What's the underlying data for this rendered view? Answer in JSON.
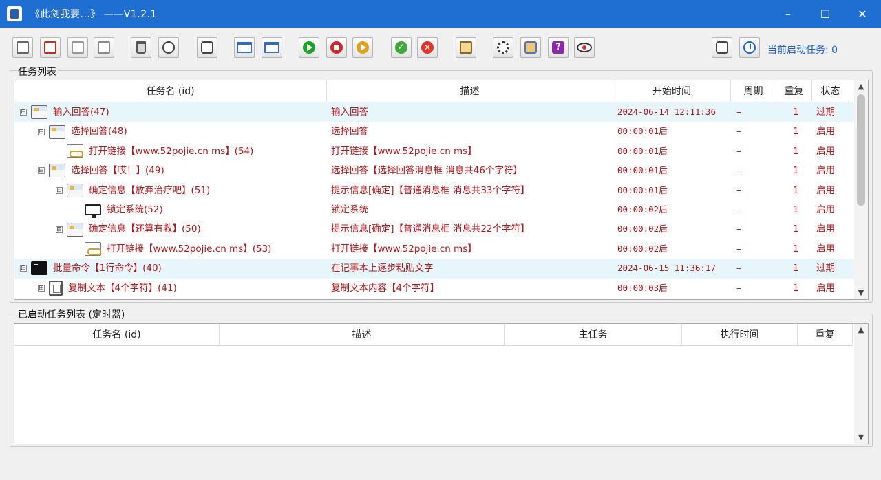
{
  "window": {
    "title": "《此剑我要...》    ——V1.2.1",
    "minimize": "–",
    "maximize": "☐",
    "close": "✕"
  },
  "toolbar": {
    "active_task_label": "当前启动任务: 0",
    "buttons": [
      {
        "name": "new-task",
        "icon": "new-task-icon"
      },
      {
        "name": "add-subtask",
        "icon": "add-subtask-icon"
      },
      {
        "name": "copy-task",
        "icon": "copy-task-icon"
      },
      {
        "name": "edit-task",
        "icon": "edit-task-icon"
      },
      {
        "name": "delete-task",
        "icon": "trash-icon"
      },
      {
        "name": "move-task",
        "icon": "arrows-icon"
      },
      {
        "name": "refresh",
        "icon": "refresh-icon"
      },
      {
        "name": "window-small",
        "icon": "window-icon"
      },
      {
        "name": "window-large",
        "icon": "window-icon"
      },
      {
        "name": "start",
        "icon": "play-icon"
      },
      {
        "name": "stop",
        "icon": "stop-icon"
      },
      {
        "name": "resume",
        "icon": "play-orange-icon"
      },
      {
        "name": "enable",
        "icon": "check-icon"
      },
      {
        "name": "disable",
        "icon": "cancel-icon"
      },
      {
        "name": "notes",
        "icon": "clipboard-icon"
      },
      {
        "name": "settings",
        "icon": "gear-icon"
      },
      {
        "name": "image",
        "icon": "image-icon"
      },
      {
        "name": "help",
        "icon": "help-icon"
      },
      {
        "name": "view",
        "icon": "eye-icon"
      },
      {
        "name": "capture",
        "icon": "capture-icon"
      },
      {
        "name": "timer",
        "icon": "stopwatch-icon"
      }
    ]
  },
  "task_list": {
    "group_label": "任务列表",
    "columns": [
      "任务名 (id)",
      "描述",
      "开始时间",
      "周期",
      "重复",
      "状态"
    ],
    "rows": [
      {
        "level": 0,
        "toggle": "⊟",
        "icon": "dialog-icon",
        "name": "输入回答(47)",
        "desc": "输入回答",
        "start": "2024-06-14 12:11:36",
        "cycle": "–",
        "repeat": "1",
        "status": "过期",
        "highlight": true
      },
      {
        "level": 1,
        "toggle": "⊟",
        "icon": "dialog-icon",
        "name": "选择回答(48)",
        "desc": "选择回答",
        "start": "00:00:01后",
        "cycle": "–",
        "repeat": "1",
        "status": "启用",
        "highlight": false
      },
      {
        "level": 2,
        "toggle": "",
        "icon": "link-icon",
        "name": "打开链接【www.52pojie.cn ms】(54)",
        "desc": "打开链接【www.52pojie.cn ms】",
        "start": "00:00:01后",
        "cycle": "–",
        "repeat": "1",
        "status": "启用",
        "highlight": false
      },
      {
        "level": 1,
        "toggle": "⊟",
        "icon": "dialog-icon",
        "name": "选择回答【哎！】(49)",
        "desc": "选择回答【选择回答消息框 消息共46个字符】",
        "start": "00:00:01后",
        "cycle": "–",
        "repeat": "1",
        "status": "启用",
        "highlight": false
      },
      {
        "level": 2,
        "toggle": "⊟",
        "icon": "dialog-icon",
        "name": "确定信息【放弃治疗吧】(51)",
        "desc": "提示信息[确定]【普通消息框 消息共33个字符】",
        "start": "00:00:01后",
        "cycle": "–",
        "repeat": "1",
        "status": "启用",
        "highlight": false
      },
      {
        "level": 3,
        "toggle": "",
        "icon": "monitor-icon",
        "name": "锁定系统(52)",
        "desc": "锁定系统",
        "start": "00:00:02后",
        "cycle": "–",
        "repeat": "1",
        "status": "启用",
        "highlight": false
      },
      {
        "level": 2,
        "toggle": "⊟",
        "icon": "dialog-icon",
        "name": "确定信息【还算有救】(50)",
        "desc": "提示信息[确定]【普通消息框 消息共22个字符】",
        "start": "00:00:02后",
        "cycle": "–",
        "repeat": "1",
        "status": "启用",
        "highlight": false
      },
      {
        "level": 3,
        "toggle": "",
        "icon": "link-icon",
        "name": "打开链接【www.52pojie.cn ms】(53)",
        "desc": "打开链接【www.52pojie.cn ms】",
        "start": "00:00:02后",
        "cycle": "–",
        "repeat": "1",
        "status": "启用",
        "highlight": false
      },
      {
        "level": 0,
        "toggle": "⊟",
        "icon": "cmd-icon",
        "name": "批量命令【1行命令】(40)",
        "desc": "在记事本上逐步粘贴文字",
        "start": "2024-06-15 11:36:17",
        "cycle": "–",
        "repeat": "1",
        "status": "过期",
        "highlight": true
      },
      {
        "level": 1,
        "toggle": "⊞",
        "icon": "copy-icon",
        "name": "复制文本【4个字符】(41)",
        "desc": "复制文本内容【4个字符】",
        "start": "00:00:03后",
        "cycle": "–",
        "repeat": "1",
        "status": "启用",
        "highlight": false
      }
    ]
  },
  "running_list": {
    "group_label": "已启动任务列表 (定时器)",
    "columns": [
      "任务名 (id)",
      "描述",
      "主任务",
      "执行时间",
      "重复"
    ]
  }
}
